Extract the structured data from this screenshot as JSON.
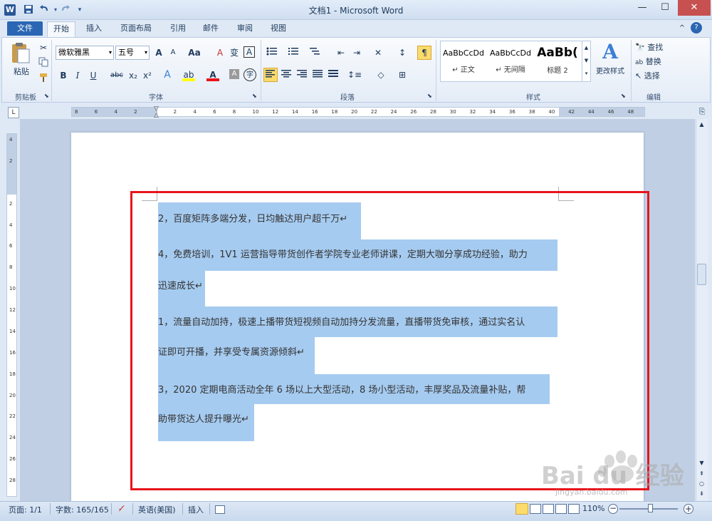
{
  "window": {
    "title": "文档1 - Microsoft Word",
    "app_icon": "W"
  },
  "quick_access": [
    "save-icon",
    "undo-icon",
    "redo-icon",
    "customize-icon"
  ],
  "tabs": [
    "文件",
    "开始",
    "插入",
    "页面布局",
    "引用",
    "邮件",
    "审阅",
    "视图"
  ],
  "ribbon": {
    "clipboard": {
      "paste": "粘贴",
      "label": "剪贴板"
    },
    "font": {
      "name": "微软雅黑",
      "size": "五号",
      "label": "字体",
      "bold": "B",
      "italic": "I",
      "underline": "U",
      "strike": "abc",
      "sub": "x₂",
      "sup": "x²",
      "grow": "A",
      "shrink": "A",
      "case": "Aa",
      "clear": "A",
      "phonetic": "变",
      "border": "A",
      "highlight": "ab",
      "font_color": "A",
      "shading": "A",
      "enclose": "字"
    },
    "paragraph": {
      "label": "段落"
    },
    "styles": {
      "label": "样式",
      "items": [
        {
          "sample": "AaBbCcDd",
          "name": "↵ 正文"
        },
        {
          "sample": "AaBbCcDd",
          "name": "↵ 无间隔"
        },
        {
          "sample": "AaBb(",
          "name": "标题 2"
        }
      ],
      "change": "更改样式"
    },
    "editing": {
      "label": "编辑",
      "find": "查找",
      "replace": "替换",
      "select": "选择"
    }
  },
  "document": {
    "paragraphs": [
      "2，百度矩阵多端分发，日均触达用户超千万↵",
      "4，免费培训，1V1 运营指导带货创作者学院专业老师讲课，定期大咖分享成功经验，助力",
      "迅速成长↵",
      "1，流量自动加持，极速上播带货短视频自动加持分发流量，直播带货免审核，通过实名认",
      "证即可开播，并享受专属资源倾斜↵",
      "3，2020 定期电商活动全年 6 场以上大型活动，8 场小型活动，丰厚奖品及流量补贴，帮",
      "助带货达人提升曝光↵"
    ]
  },
  "ruler": {
    "ticks": [
      "8",
      "6",
      "4",
      "2",
      "",
      "2",
      "4",
      "6",
      "8",
      "10",
      "12",
      "14",
      "16",
      "18",
      "20",
      "22",
      "24",
      "26",
      "28",
      "30",
      "32",
      "34",
      "36",
      "38",
      "40",
      "42",
      "44",
      "46",
      "48"
    ]
  },
  "vruler": {
    "ticks": [
      "4",
      "2",
      "",
      "2",
      "4",
      "6",
      "8",
      "10",
      "12",
      "14",
      "16",
      "18",
      "20",
      "22",
      "24",
      "26",
      "28"
    ]
  },
  "status": {
    "page": "页面: 1/1",
    "words": "字数: 165/165",
    "language": "英语(美国)",
    "mode": "插入",
    "zoom": "110%"
  },
  "watermark": {
    "text": "Bai du 经验",
    "url": "jingyan.baidu.com"
  },
  "colors": {
    "selection": "#a6cbf0",
    "red_box": "#e8141b",
    "file_tab": "#2a66b3"
  }
}
